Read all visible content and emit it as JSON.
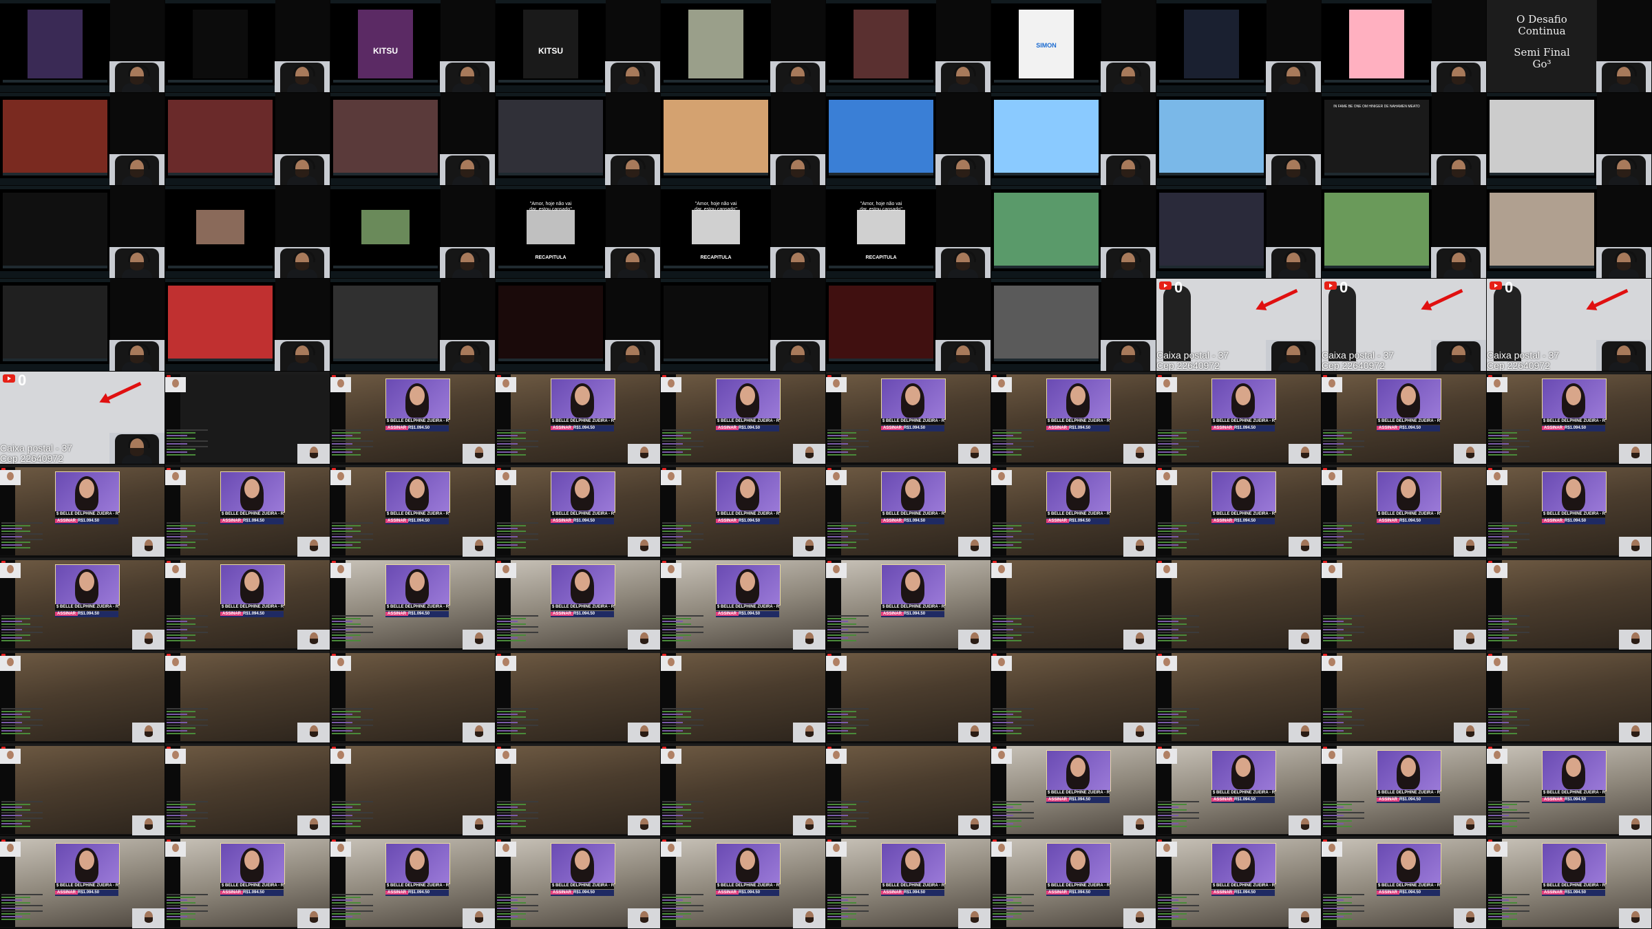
{
  "grid": {
    "rows": 10,
    "cols": 10
  },
  "title_card": {
    "line1": "O Desafio",
    "line2": "Continua",
    "line3": "Semi Final",
    "line4": "Go³"
  },
  "youtube_counter": {
    "count": "0"
  },
  "caption": {
    "line1": "Caixa postal - 37",
    "line2": "Cep 22640972"
  },
  "overlays": {
    "kitsu": "KITSU",
    "recap_line1": "\"Amor, hoje não vai",
    "recap_line2": "dar, estou cansado\"",
    "recap_word": "RECAPITULA",
    "chipmunk": "SIMON",
    "meme_text": "IN FAME BE ONE OM HINIGER DE NAHAMEN MEATO"
  },
  "stream": {
    "ticker": "$ BELLE DELPHINE ZUEIRA - R$10",
    "goal_label": "ASSINAR",
    "goal_value": "R$1.094.50"
  },
  "colors": {
    "accent_red": "#e01010",
    "stream_purple": "#8a68c9",
    "goal_blue": "#1f2a63",
    "goal_pink": "#e23f7d"
  }
}
